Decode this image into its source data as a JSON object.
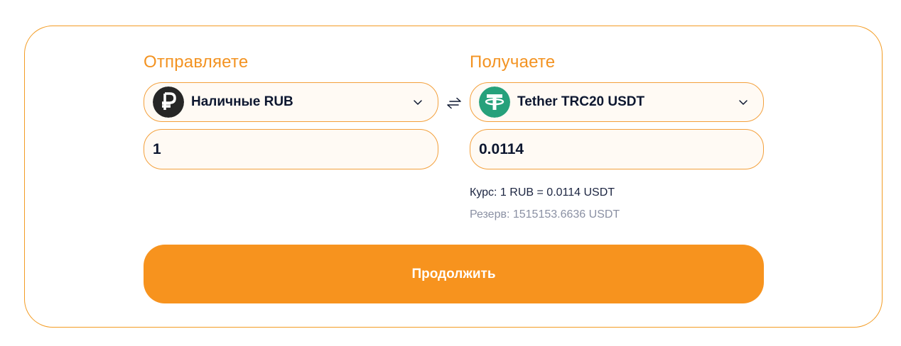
{
  "send": {
    "heading": "Отправляете",
    "currency": {
      "label": "Наличные RUB",
      "icon": "ruble-icon",
      "icon_color": "#262626"
    },
    "amount": "1"
  },
  "receive": {
    "heading": "Получаете",
    "currency": {
      "label": "Tether TRC20 USDT",
      "icon": "tether-icon",
      "icon_color": "#26a17b"
    },
    "amount": "0.0114"
  },
  "rate_text": "Курс: 1 RUB = 0.0114 USDT",
  "reserve_text": "Резерв: 1515153.6636 USDT",
  "continue_label": "Продолжить",
  "colors": {
    "accent": "#f7931e",
    "border": "#f3a03c",
    "text_dark": "#0d1730",
    "text_muted": "#8a90a3"
  }
}
